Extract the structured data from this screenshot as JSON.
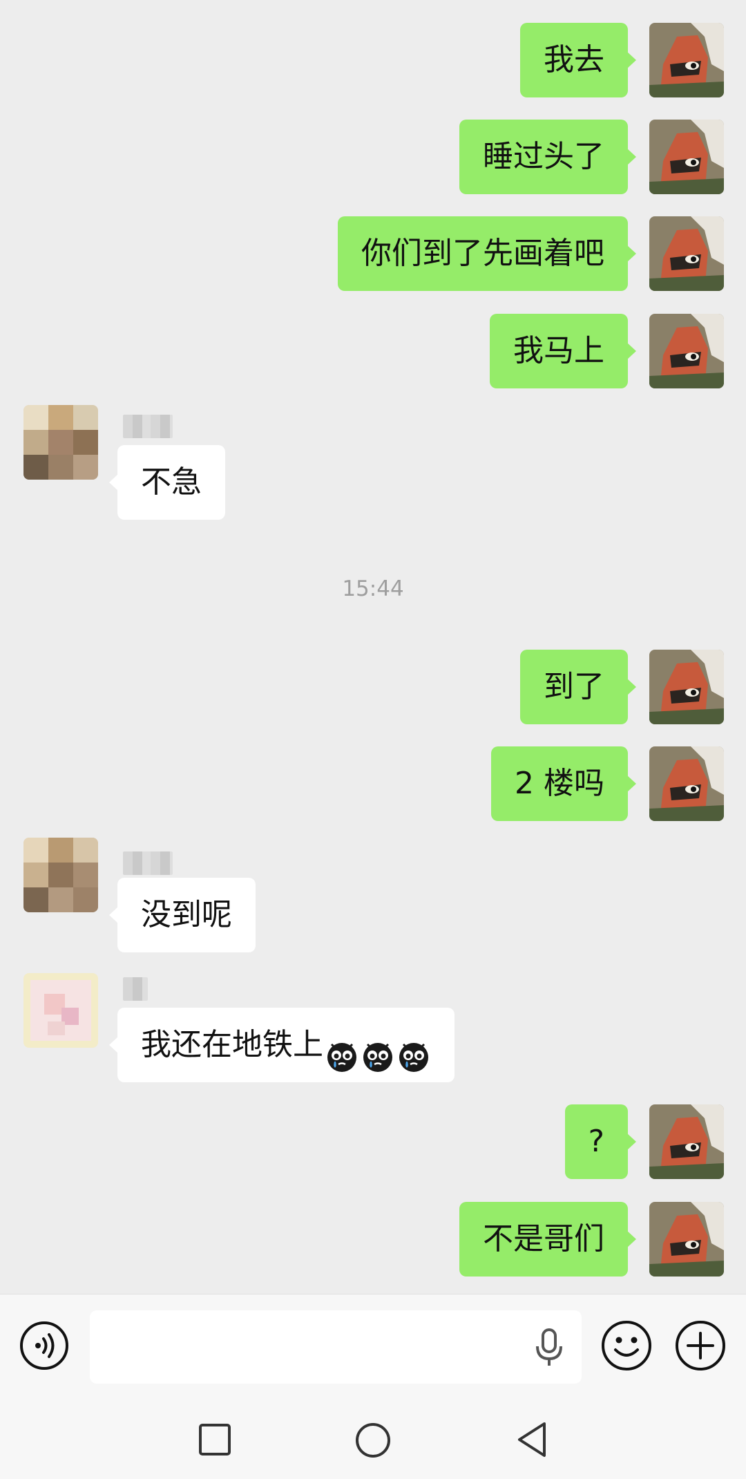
{
  "messages": [
    {
      "dir": "out",
      "text": "我去"
    },
    {
      "dir": "out",
      "text": "睡过头了"
    },
    {
      "dir": "out",
      "text": "你们到了先画着吧"
    },
    {
      "dir": "out",
      "text": "我马上"
    },
    {
      "dir": "in",
      "text": "不急"
    },
    {
      "dir": "out",
      "text": "到了"
    },
    {
      "dir": "out",
      "text": "2 楼吗"
    },
    {
      "dir": "in",
      "text": "没到呢"
    },
    {
      "dir": "in",
      "text": "我还在地铁上"
    },
    {
      "dir": "out",
      "text": "?"
    },
    {
      "dir": "out",
      "text": "不是哥们"
    }
  ],
  "timestamp": "15:44",
  "emoji_name": "crying-face-emoji",
  "emoji_count": 3,
  "colors": {
    "outgoing_bubble": "#95ec69",
    "incoming_bubble": "#ffffff",
    "chat_background": "#ededed",
    "timestamp_text": "#9e9e9e"
  },
  "input_bar": {
    "voice_icon": "voice-wave-icon",
    "mic_icon": "microphone-icon",
    "emoji_icon": "smiley-icon",
    "plus_icon": "plus-icon"
  },
  "nav_bar": {
    "icons": [
      "square-recents-icon",
      "circle-home-icon",
      "triangle-back-icon"
    ]
  }
}
